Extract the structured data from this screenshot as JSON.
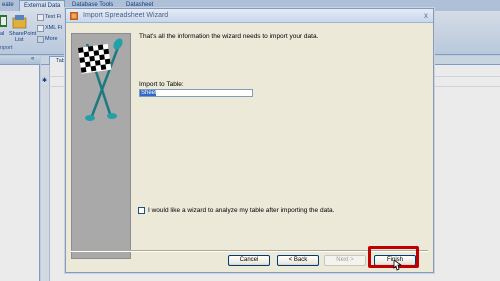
{
  "ribbon": {
    "tabs": [
      "eate",
      "External Data",
      "Database Tools",
      "Datasheet"
    ],
    "active_tab": "External Data",
    "buttons": [
      {
        "label": "al",
        "icon": "excel-icon"
      },
      {
        "label": "SharePoint",
        "sublabel": "List",
        "icon": "sharepoint-list-icon"
      },
      {
        "label": "Text Fi",
        "icon": "text-file-icon"
      },
      {
        "label": "XML Fi",
        "icon": "xml-file-icon"
      },
      {
        "label": "More",
        "icon": "more-icon"
      }
    ],
    "group_label": "nport"
  },
  "nav_pane": {
    "buttons": [
      "«"
    ]
  },
  "sheet": {
    "tab_label": "Tab",
    "row_marker": "✱"
  },
  "wizard": {
    "title": "Import Spreadsheet Wizard",
    "close_glyph": "x",
    "intro_text": "That's all the information the wizard needs to import your data.",
    "import_to_label": "Import to Table:",
    "import_to_value": "Sheet1",
    "analyze_checkbox_label": "I would like a wizard to analyze my table after importing the data.",
    "analyze_checked": false,
    "buttons": {
      "cancel": "Cancel",
      "back": "< Back",
      "next": "Next >",
      "finish": "Finish"
    },
    "highlight_color": "#c00000"
  }
}
